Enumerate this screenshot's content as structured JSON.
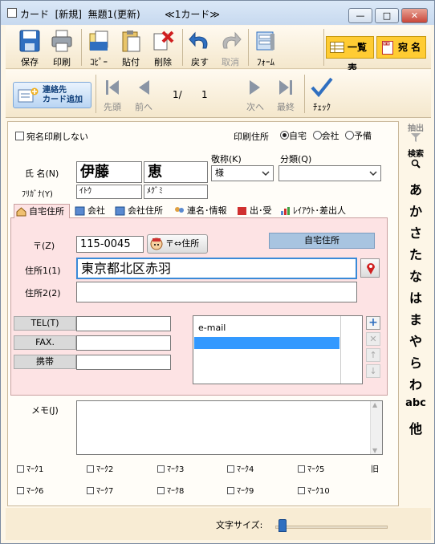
{
  "window": {
    "title": "カード  [新規]  無題1(更新)        ≪1カード≫",
    "btn_min": "—",
    "btn_max": "□",
    "btn_close": "✕"
  },
  "toolbar1": {
    "save": "保存",
    "print": "印刷",
    "copy": "ｺﾋﾟｰ",
    "paste": "貼付",
    "delete": "削除",
    "undo": "戻す",
    "redo": "取消",
    "form": "ﾌｫｰﾑ",
    "list_btn": "一覧表",
    "address_btn": "宛 名"
  },
  "toolbar2": {
    "add_card_line1": "連絡先",
    "add_card_line2": "カード追加",
    "first": "先頭",
    "prev": "前へ",
    "record_current": "1/",
    "record_total": "1",
    "next": "次へ",
    "last": "最終",
    "check": "ﾁｪｯｸ"
  },
  "form": {
    "no_print_label": "宛名印刷しない",
    "print_address_label": "印刷住所",
    "radio_home": "自宅",
    "radio_company": "会社",
    "radio_spare": "予備",
    "honorific_label": "敬称(K)",
    "category_label": "分類(Q)",
    "name_label": "氏  名(N)",
    "furigana_label": "ﾌﾘｶﾞﾅ(Y)",
    "last_name": "伊藤",
    "first_name": "恵",
    "last_kana": "ｲﾄｳ",
    "first_kana": "ﾒｸﾞﾐ",
    "honorific_value": "様",
    "category_value": ""
  },
  "tabs": [
    "自宅住所",
    "会社",
    "会社住所",
    "連名･情報",
    "出･受",
    "ﾚｲｱｳﾄ･差出人"
  ],
  "address": {
    "zip_label": "〒(Z)",
    "zip_value": "115-0045",
    "zip_convert": "〒⇔住所",
    "panel_title": "自宅住所",
    "addr1_label": "住所1(1)",
    "addr1_value": "東京都北区赤羽",
    "addr2_label": "住所2(2)",
    "addr2_value": "",
    "tel_label": "TEL(T)",
    "fax_label": "FAX.",
    "mobile_label": "携帯",
    "tel_value": "",
    "fax_value": "",
    "mobile_value": "",
    "email_header": "e-mail",
    "email_value": ""
  },
  "memo": {
    "label": "メモ(J)",
    "value": ""
  },
  "marks": [
    "ﾏｰｸ1",
    "ﾏｰｸ2",
    "ﾏｰｸ3",
    "ﾏｰｸ4",
    "ﾏｰｸ5",
    "ﾏｰｸ6",
    "ﾏｰｸ7",
    "ﾏｰｸ8",
    "ﾏｰｸ9",
    "ﾏｰｸ10"
  ],
  "marks_extra": "旧",
  "footer": {
    "font_size_label": "文字サイズ:",
    "font_size_level": 0.02
  },
  "sidebar": {
    "extract": "抽出",
    "search": "検索",
    "kana": [
      "あ",
      "か",
      "さ",
      "た",
      "な",
      "は",
      "ま",
      "や",
      "ら",
      "わ"
    ],
    "abc": "abc",
    "other": "他"
  },
  "colors": {
    "accent_blue": "#3399ff",
    "tab_pink": "#fde3e4",
    "toolbar_yellow": "#ffcc33"
  }
}
